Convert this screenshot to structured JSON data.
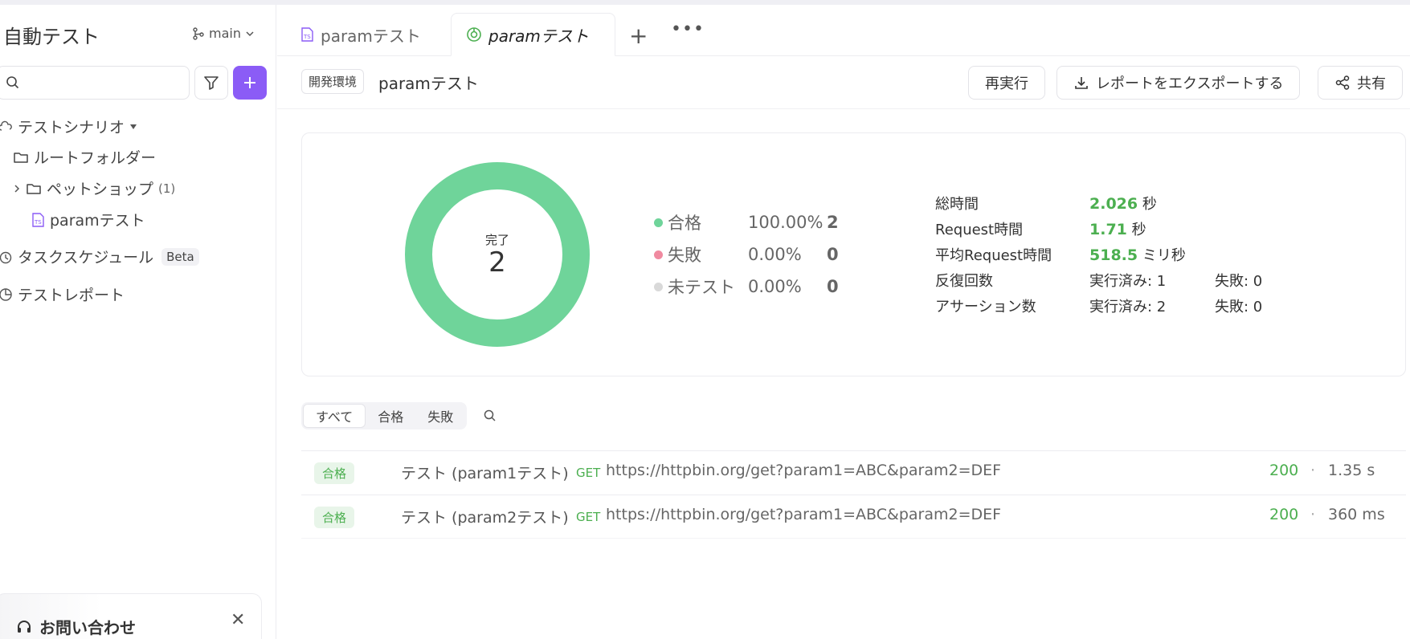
{
  "sidebar": {
    "title": "自動テスト",
    "branch": "main",
    "search_placeholder": "",
    "tree": {
      "scenarios_label": "テストシナリオ",
      "root_folder": "ルートフォルダー",
      "petshop": "ペットショップ",
      "petshop_count": "(1)",
      "param_test": "paramテスト",
      "task_schedule": "タスクスケジュール",
      "beta": "Beta",
      "test_report": "テストレポート"
    },
    "contact": "お問い合わせ"
  },
  "tabs": [
    {
      "label": "paramテスト"
    },
    {
      "label": "paramテスト"
    }
  ],
  "toolbar": {
    "env": "開発環境",
    "title": "paramテスト",
    "rerun": "再実行",
    "export": "レポートをエクスポートする",
    "share": "共有"
  },
  "summary": {
    "donut_label": "完了",
    "donut_value": "2",
    "legend": [
      {
        "name": "合格",
        "pct": "100.00%",
        "count": "2",
        "color": "#6fd49a"
      },
      {
        "name": "失敗",
        "pct": "0.00%",
        "count": "0",
        "color": "#f08aa0"
      },
      {
        "name": "未テスト",
        "pct": "0.00%",
        "count": "0",
        "color": "#d9d9d9"
      }
    ],
    "stats": {
      "total_time_label": "総時間",
      "total_time_value": "2.026",
      "total_time_unit": "秒",
      "request_time_label": "Request時間",
      "request_time_value": "1.71",
      "request_time_unit": "秒",
      "avg_request_label": "平均Request時間",
      "avg_request_value": "518.5",
      "avg_request_unit": "ミリ秒",
      "iterations_label": "反復回数",
      "iterations_done": "実行済み: 1",
      "iterations_failed": "失敗: 0",
      "assertions_label": "アサーション数",
      "assertions_done": "実行済み: 2",
      "assertions_failed": "失敗: 0"
    }
  },
  "filters": [
    "すべて",
    "合格",
    "失敗"
  ],
  "results": [
    {
      "status": "合格",
      "name": "テスト (param1テスト)",
      "method": "GET",
      "url": "https://httpbin.org/get?param1=ABC&param2=DEF",
      "code": "200",
      "sep": "·",
      "time": "1.35 s"
    },
    {
      "status": "合格",
      "name": "テスト (param2テスト)",
      "method": "GET",
      "url": "https://httpbin.org/get?param1=ABC&param2=DEF",
      "code": "200",
      "sep": "·",
      "time": "360 ms"
    }
  ],
  "colors": {
    "accent": "#8b5cf6",
    "pass": "#6fd49a",
    "green_text": "#4caf50"
  }
}
